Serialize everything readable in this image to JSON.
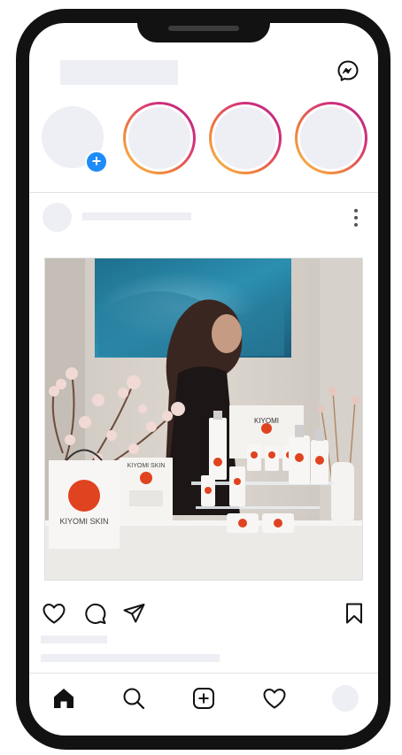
{
  "app": {
    "name": "Instagram-style feed mockup"
  },
  "header": {
    "logo_placeholder": "",
    "messenger_icon": "messenger-icon"
  },
  "stories": {
    "own": {
      "add_symbol": "+"
    },
    "items": [
      {
        "ring_colors": [
          "#f9c64a",
          "#ee7b3e",
          "#d4317b",
          "#b6297f"
        ]
      },
      {
        "ring_colors": [
          "#f9c64a",
          "#ee7b3e",
          "#d4317b",
          "#b6297f"
        ]
      },
      {
        "ring_colors": [
          "#f9c64a",
          "#ee7b3e",
          "#d4317b",
          "#b6297f"
        ]
      }
    ]
  },
  "post": {
    "photo": {
      "brand_bag": "KIYOMI SKIN",
      "brand_box": "KIYOMI SKIN",
      "brand_display": "KIYOMI"
    },
    "actions": [
      "heart-icon",
      "comment-icon",
      "share-icon",
      "bookmark-icon"
    ]
  },
  "tabbar": {
    "items": [
      "home-icon",
      "search-icon",
      "create-icon",
      "activity-icon",
      "profile-avatar"
    ]
  },
  "colors": {
    "accent_blue": "#1d8cf8",
    "placeholder": "#eeeff4",
    "brand_red": "#e0431f"
  }
}
